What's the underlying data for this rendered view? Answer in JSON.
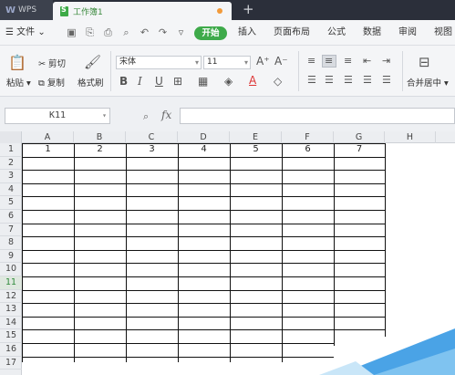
{
  "titlebar": {
    "app_tab": "WPS",
    "doc_tab": "工作簿1",
    "new_tab": "+"
  },
  "menubar": {
    "file": "文件",
    "start": "开始",
    "tabs": [
      "插入",
      "页面布局",
      "公式",
      "数据",
      "审阅",
      "视图"
    ]
  },
  "ribbon": {
    "paste": "粘贴",
    "cut": "剪切",
    "copy": "复制",
    "format_painter": "格式刷",
    "font_name": "宋体",
    "font_size": "11",
    "merge_center": "合并居中"
  },
  "formula": {
    "name_box": "K11",
    "fx": "fx"
  },
  "sheet": {
    "columns": [
      "A",
      "B",
      "C",
      "D",
      "E",
      "F",
      "G",
      "H"
    ],
    "rows": [
      "1",
      "2",
      "3",
      "4",
      "5",
      "6",
      "7",
      "8",
      "9",
      "10",
      "11",
      "12",
      "13",
      "14",
      "15",
      "16",
      "17"
    ],
    "active_row": "11",
    "row1_values": [
      "1",
      "2",
      "3",
      "4",
      "5",
      "6",
      "7"
    ]
  },
  "colors": {
    "accent_green": "#3eaa4a",
    "title_bg": "#2b2f3a"
  }
}
